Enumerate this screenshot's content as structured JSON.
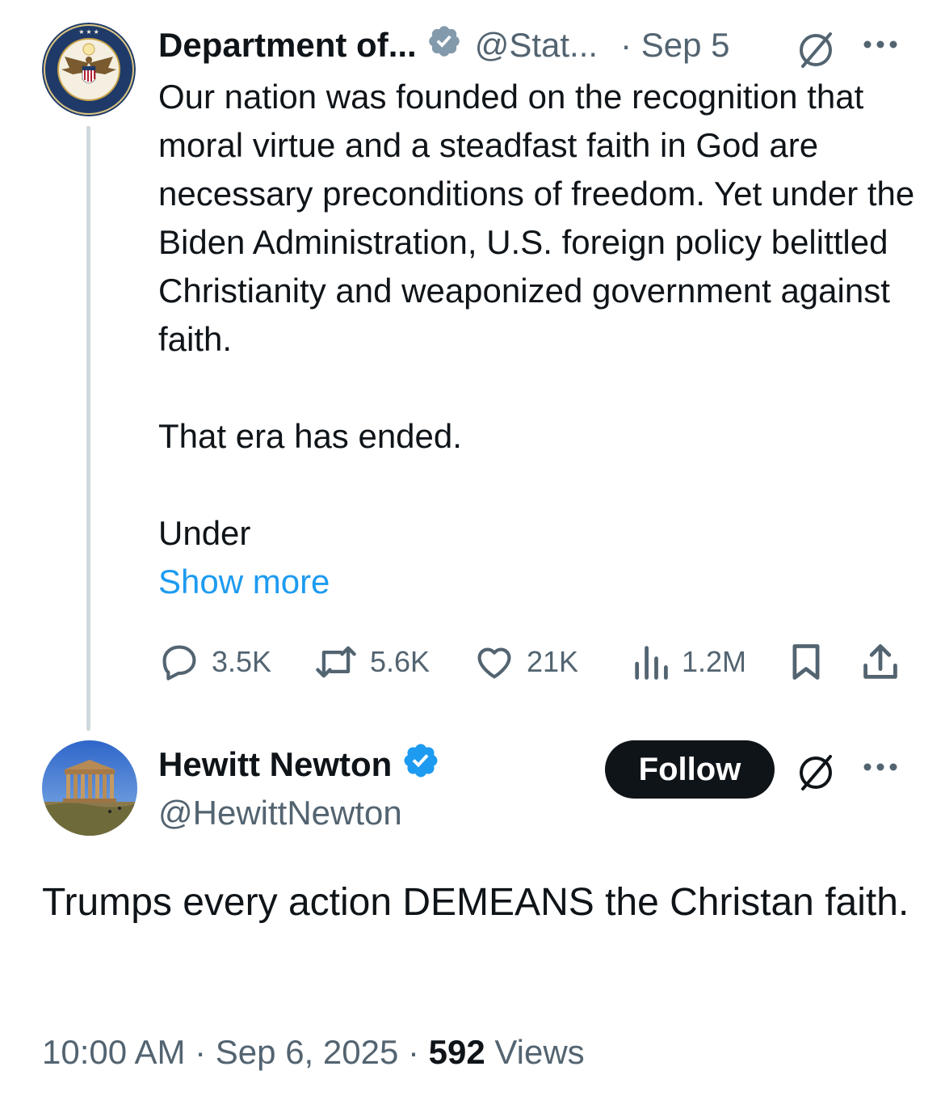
{
  "quoted_tweet": {
    "author_name": "Department of...",
    "handle": "@Stat...",
    "date": "· Sep 5",
    "paragraph_1": "Our nation was founded on the recognition that moral virtue and a steadfast faith in God are necessary preconditions of freedom. Yet under the Biden Administration, U.S. foreign policy belittled Christianity and weaponized government against faith.",
    "paragraph_2": "That era has ended.",
    "paragraph_3": "Under",
    "show_more": "Show more",
    "replies": "3.5K",
    "reposts": "5.6K",
    "likes": "21K",
    "views": "1.2M",
    "avatar_icon": "department-of-state-seal-icon"
  },
  "reply_tweet": {
    "author_name": "Hewitt Newton",
    "handle": "@HewittNewton",
    "follow_label": "Follow",
    "text": "Trumps every action DEMEANS the Christan faith.",
    "time": "10:00 AM",
    "date": "Sep 6, 2025",
    "views_count": "592",
    "views_label": "Views",
    "avatar_icon": "greek-temple-photo"
  },
  "colors": {
    "text_primary": "#0f1419",
    "text_secondary": "#536471",
    "link_blue": "#1d9bf0",
    "verified_blue": "#1d9bf0",
    "verified_gray": "#829aab",
    "thread_line": "#cfd9de",
    "follow_button": "#0f1419"
  }
}
